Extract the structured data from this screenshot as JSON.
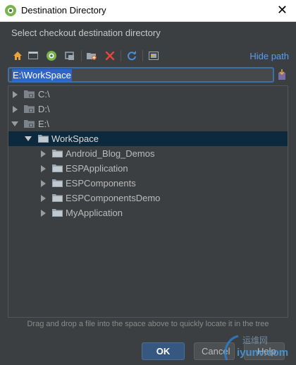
{
  "window": {
    "title": "Destination Directory",
    "close_glyph": "✕"
  },
  "prompt": "Select checkout destination directory",
  "toolbar": {
    "icons": [
      "home-icon",
      "desktop-icon",
      "android-project-icon",
      "module-icon",
      "new-folder-icon",
      "delete-icon",
      "refresh-icon",
      "show-hidden-icon"
    ],
    "hide_path_label": "Hide path"
  },
  "path": {
    "value": "E:\\WorkSpace"
  },
  "tree": {
    "nodes": [
      {
        "label": "C:\\",
        "expanded": false,
        "type": "drive"
      },
      {
        "label": "D:\\",
        "expanded": false,
        "type": "drive"
      },
      {
        "label": "E:\\",
        "expanded": true,
        "type": "drive"
      },
      {
        "label": "WorkSpace",
        "expanded": true,
        "type": "folder",
        "selected": true
      },
      {
        "label": "Android_Blog_Demos",
        "expanded": false,
        "type": "folder"
      },
      {
        "label": "ESPApplication",
        "expanded": false,
        "type": "folder"
      },
      {
        "label": "ESPComponents",
        "expanded": false,
        "type": "folder"
      },
      {
        "label": "ESPComponentsDemo",
        "expanded": false,
        "type": "folder"
      },
      {
        "label": "MyApplication",
        "expanded": false,
        "type": "folder"
      }
    ]
  },
  "hint": "Drag and drop a file into the space above to quickly locate it in the tree",
  "buttons": {
    "ok": "OK",
    "cancel": "Cancel",
    "help": "Help"
  },
  "watermark": {
    "text": "iyunv.com",
    "brand": "运维网"
  },
  "colors": {
    "accent": "#589df6",
    "selection": "#0d293e",
    "ok_button": "#365880",
    "background": "#3c3f41"
  }
}
